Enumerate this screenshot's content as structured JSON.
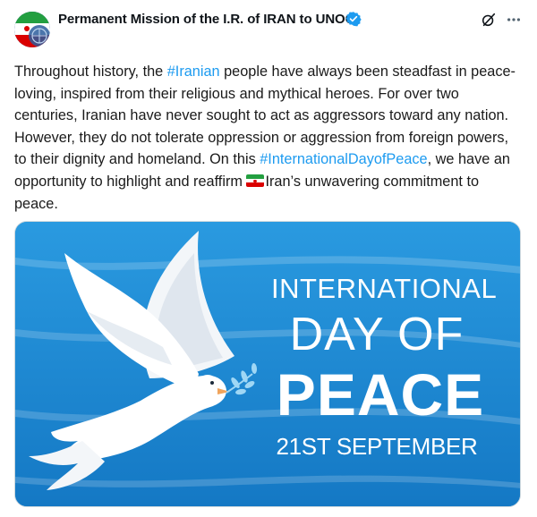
{
  "post": {
    "author": {
      "name": "Permanent Mission of the I.R. of IRAN to UNOG",
      "verified": true,
      "avatar_icon": "mission-flag-avatar"
    },
    "actions": {
      "grok_icon": "grok-icon",
      "more_icon": "more-options-icon"
    },
    "text": {
      "part1": "Throughout history, the ",
      "hashtag1": "#Iranian",
      "part2": " people have always been steadfast in peace-loving, inspired from their religious and mythical heroes. For over two centuries, Iranian have never sought to act as aggressors toward any nation. However, they do not tolerate oppression or aggression from foreign powers, to their dignity and homeland. On this ",
      "hashtag2": "#InternationalDayofPeace",
      "part3": ", we have an opportunity to highlight and reaffirm ",
      "flag_emoji": "iran-flag-emoji",
      "part4": "Iran’s unwavering commitment to peace."
    },
    "media": {
      "line1": "INTERNATIONAL",
      "line2": "DAY OF",
      "line3": "PEACE",
      "line4": "21ST SEPTEMBER",
      "image_icon": "white-dove-with-olive-branch"
    },
    "colors": {
      "hashtag": "#1d9bf0",
      "verified_badge": "#1d9bf0",
      "poster_blue": "#1c8fd6",
      "poster_light_blue": "#52b6ee",
      "flag_green": "#239f40",
      "flag_red": "#da0000"
    }
  }
}
